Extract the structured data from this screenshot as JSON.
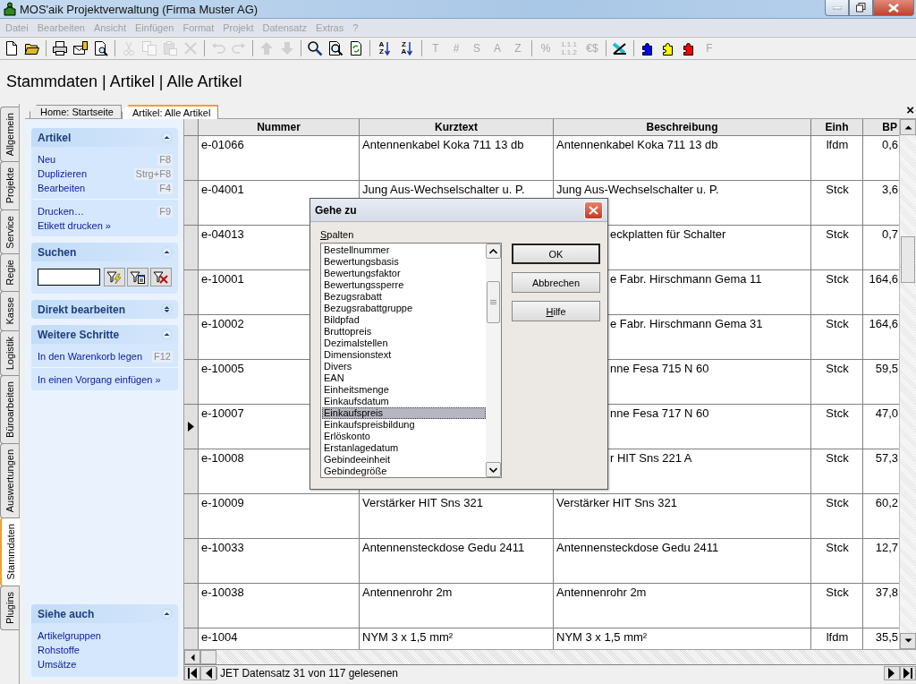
{
  "window": {
    "title": "MOS'aik Projektverwaltung (Firma Muster AG)"
  },
  "menu": [
    {
      "label": "Datei",
      "disabled": true
    },
    {
      "label": "Bearbeiten",
      "disabled": true
    },
    {
      "label": "Ansicht",
      "disabled": true
    },
    {
      "label": "Einfügen",
      "disabled": true
    },
    {
      "label": "Format",
      "disabled": true
    },
    {
      "label": "Projekt",
      "disabled": true
    },
    {
      "label": "Datensatz",
      "disabled": true
    },
    {
      "label": "Extras",
      "disabled": true
    },
    {
      "label": "?",
      "disabled": true
    }
  ],
  "toolbar": [
    [
      {
        "kind": "page",
        "disabled": false
      },
      {
        "kind": "folder",
        "disabled": false
      }
    ],
    [
      {
        "kind": "printer",
        "disabled": false
      },
      {
        "kind": "envelope",
        "disabled": false
      },
      {
        "kind": "preview",
        "disabled": false
      }
    ],
    [
      {
        "kind": "scissors",
        "disabled": true
      },
      {
        "kind": "copy",
        "disabled": true
      },
      {
        "kind": "paste",
        "disabled": true
      },
      {
        "kind": "cross",
        "disabled": true
      }
    ],
    [
      {
        "kind": "undo",
        "disabled": true
      },
      {
        "kind": "redo",
        "disabled": true
      }
    ],
    [
      {
        "kind": "up",
        "disabled": true
      },
      {
        "kind": "down",
        "disabled": true
      }
    ],
    [
      {
        "kind": "magnifier",
        "disabled": false
      },
      {
        "kind": "pagefind",
        "disabled": false
      },
      {
        "kind": "refresh",
        "disabled": false
      }
    ],
    [
      {
        "kind": "sort",
        "label": "AZ",
        "disabled": false
      },
      {
        "kind": "sort",
        "label": "ZA",
        "disabled": false
      }
    ],
    [
      {
        "kind": "text",
        "label": "T",
        "disabled": true
      },
      {
        "kind": "text",
        "label": "#",
        "disabled": true
      },
      {
        "kind": "text",
        "label": "S",
        "disabled": true
      },
      {
        "kind": "text",
        "label": "A",
        "disabled": true
      },
      {
        "kind": "text",
        "label": "Z",
        "disabled": true
      }
    ],
    [
      {
        "kind": "text",
        "label": "%",
        "disabled": true
      },
      {
        "kind": "stack",
        "lines": [
          "1.1.1",
          "1.1.2"
        ],
        "disabled": true
      },
      {
        "kind": "text",
        "label": "€$",
        "disabled": true
      }
    ],
    [
      {
        "kind": "tools",
        "disabled": false
      }
    ],
    [
      {
        "kind": "puzzle",
        "color": "#0000ff",
        "disabled": false
      },
      {
        "kind": "puzzle",
        "color": "#ffff00",
        "disabled": false
      },
      {
        "kind": "puzzle",
        "color": "#ff0000",
        "disabled": false
      },
      {
        "kind": "text",
        "label": "F",
        "disabled": true
      }
    ]
  ],
  "page_title": "Stammdaten | Artikel | Alle Artikel",
  "side_tabs": [
    {
      "label": "Allgemein",
      "selected": false
    },
    {
      "label": "Projekte",
      "selected": false
    },
    {
      "label": "Service",
      "selected": false
    },
    {
      "label": "Regie",
      "selected": false
    },
    {
      "label": "Kasse",
      "selected": false
    },
    {
      "label": "Logistik",
      "selected": false
    },
    {
      "label": "Büroarbeiten",
      "selected": false
    },
    {
      "label": "Auswertungen",
      "selected": false
    },
    {
      "label": "Stammdaten",
      "selected": true
    },
    {
      "label": "Plugins",
      "selected": false
    }
  ],
  "doc_tabs": [
    {
      "label": "Home: Startseite",
      "selected": false
    },
    {
      "label": "Artikel: Alle Artikel",
      "selected": true
    }
  ],
  "close_tabs": "×",
  "task_groups": [
    {
      "kind": "links",
      "title": "Artikel",
      "expanded": true,
      "sections": [
        [
          {
            "label": "Neu",
            "shortcut": "F8"
          },
          {
            "label": "Duplizieren",
            "shortcut": "Strg+F8"
          },
          {
            "label": "Bearbeiten",
            "shortcut": "F4"
          }
        ],
        [
          {
            "label": "Drucken…",
            "shortcut": "F9"
          },
          {
            "label": "Etikett drucken »"
          }
        ]
      ]
    },
    {
      "kind": "search",
      "title": "Suchen",
      "expanded": true,
      "buttons": [
        {
          "kind": "bolt"
        },
        {
          "kind": "list"
        },
        {
          "kind": "clear"
        }
      ]
    },
    {
      "title": "Direkt bearbeiten",
      "expanded": false
    },
    {
      "kind": "links",
      "title": "Weitere Schritte",
      "expanded": true,
      "sections": [
        [
          {
            "label": "In den Warenkorb legen",
            "shortcut": "F12"
          }
        ],
        [
          {
            "label": "In einen Vorgang einfügen »"
          }
        ]
      ]
    }
  ],
  "see_also": {
    "title": "Siehe auch",
    "expanded": true,
    "links": [
      "Artikelgruppen",
      "Rohstoffe",
      "Umsätze"
    ]
  },
  "table": {
    "columns": [
      "Nummer",
      "Kurztext",
      "Beschreibung",
      "Einh",
      "BP"
    ],
    "rows": [
      {
        "nummer": "e-01066",
        "kurztext": "Antennenkabel Koka 711 13 db",
        "beschreibung": "Antennenkabel Koka 711 13 db",
        "covered": false,
        "einh": "lfdm",
        "bp": "0,6",
        "selected": false
      },
      {
        "nummer": "e-04001",
        "kurztext": "Jung Aus-Wechselschalter u. P.",
        "beschreibung": "Jung Aus-Wechselschalter u. P.",
        "covered": false,
        "einh": "Stck",
        "bp": "3,6",
        "selected": false
      },
      {
        "nummer": "e-04013",
        "beschreibung": "eckplatten für Schalter",
        "covered": true,
        "einh": "Stck",
        "bp": "0,7",
        "selected": false
      },
      {
        "nummer": "e-10001",
        "beschreibung": "e Fabr. Hirschmann Gema 11",
        "covered": true,
        "einh": "Stck",
        "bp": "164,6",
        "selected": false
      },
      {
        "nummer": "e-10002",
        "beschreibung": "e Fabr. Hirschmann Gema 31",
        "covered": true,
        "einh": "Stck",
        "bp": "164,6",
        "selected": false
      },
      {
        "nummer": "e-10005",
        "beschreibung": "nne Fesa 715 N 60",
        "covered": true,
        "einh": "Stck",
        "bp": "59,5",
        "selected": false
      },
      {
        "nummer": "e-10007",
        "beschreibung": "nne Fesa 717 N 60",
        "covered": true,
        "einh": "Stck",
        "bp": "47,0",
        "selected": true
      },
      {
        "nummer": "e-10008",
        "beschreibung": "r HIT Sns 221 A",
        "covered": true,
        "einh": "Stck",
        "bp": "57,3",
        "selected": false
      },
      {
        "nummer": "e-10009",
        "kurztext": "Verstärker HIT Sns 321",
        "beschreibung": "Verstärker HIT Sns 321",
        "covered": false,
        "einh": "Stck",
        "bp": "60,2",
        "selected": false
      },
      {
        "nummer": "e-10033",
        "kurztext": "Antennensteckdose Gedu 2411",
        "beschreibung": "Antennensteckdose Gedu 2411",
        "covered": false,
        "einh": "Stck",
        "bp": "12,7",
        "selected": false
      },
      {
        "nummer": "e-10038",
        "kurztext": "Antennenrohr 2m",
        "beschreibung": "Antennenrohr 2m",
        "covered": false,
        "einh": "Stck",
        "bp": "37,8",
        "selected": false
      },
      {
        "nummer": "e-1004",
        "kurztext": "NYM 3 x 1,5 mm²",
        "beschreibung": "NYM 3 x 1,5 mm²",
        "covered": false,
        "einh": "lfdm",
        "bp": "35,5",
        "selected": false
      }
    ]
  },
  "status": "JET Datensatz 31 von 117 gelesenen",
  "dialog": {
    "title": "Gehe zu",
    "list_label": {
      "label": "Spalten",
      "mnemonic": true
    },
    "items": [
      {
        "label": "Bestellnummer",
        "selected": false
      },
      {
        "label": "Bewertungsbasis",
        "selected": false
      },
      {
        "label": "Bewertungsfaktor",
        "selected": false
      },
      {
        "label": "Bewertungssperre",
        "selected": false
      },
      {
        "label": "Bezugsrabatt",
        "selected": false
      },
      {
        "label": "Bezugsrabattgruppe",
        "selected": false
      },
      {
        "label": "Bildpfad",
        "selected": false
      },
      {
        "label": "Bruttopreis",
        "selected": false
      },
      {
        "label": "Dezimalstellen",
        "selected": false
      },
      {
        "label": "Dimensionstext",
        "selected": false
      },
      {
        "label": "Divers",
        "selected": false
      },
      {
        "label": "EAN",
        "selected": false
      },
      {
        "label": "Einheitsmenge",
        "selected": false
      },
      {
        "label": "Einkaufsdatum",
        "selected": false
      },
      {
        "label": "Einkaufspreis",
        "selected": true
      },
      {
        "label": "Einkaufspreisbildung",
        "selected": false
      },
      {
        "label": "Erlöskonto",
        "selected": false
      },
      {
        "label": "Erstanlagedatum",
        "selected": false
      },
      {
        "label": "Gebindeeinheit",
        "selected": false
      },
      {
        "label": "Gebindegröße",
        "selected": false
      }
    ],
    "buttons": [
      {
        "label": "OK",
        "default": true,
        "mnemonic": false
      },
      {
        "label": "Abbrechen",
        "default": false,
        "mnemonic": false
      },
      {
        "label": "Hilfe",
        "default": false,
        "mnemonic": true
      }
    ]
  }
}
